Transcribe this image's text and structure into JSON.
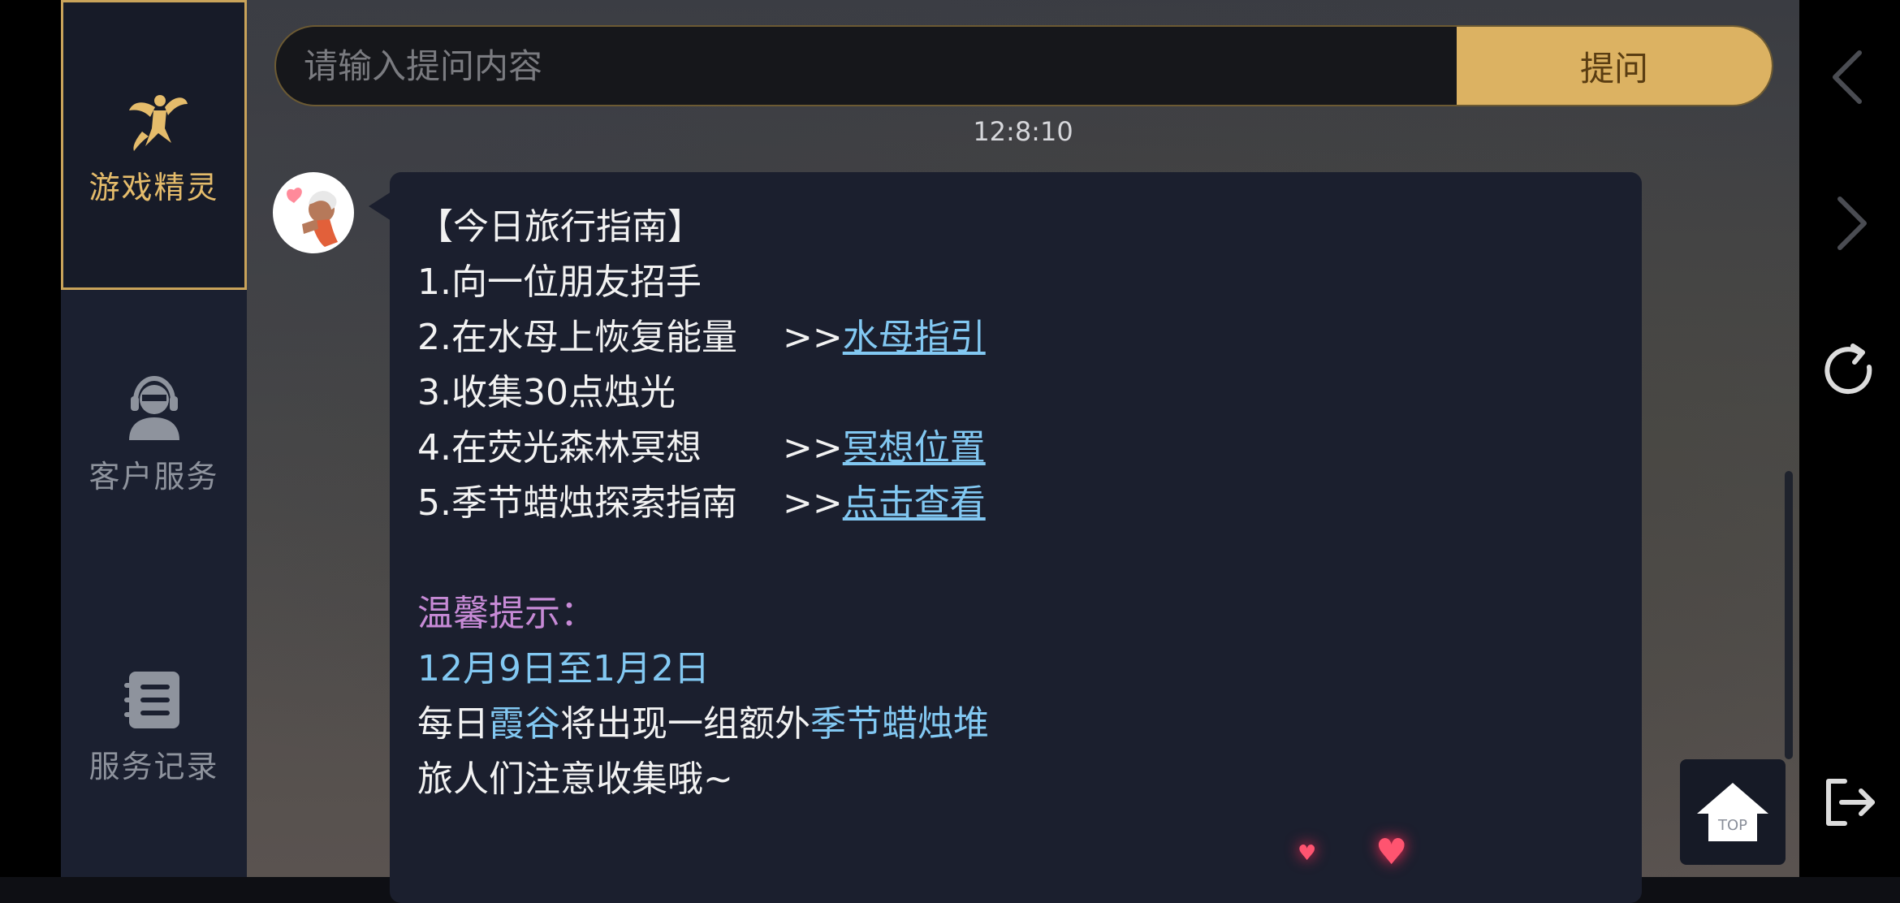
{
  "sidebar": {
    "items": [
      {
        "label": "游戏精灵",
        "icon": "fairy-icon",
        "active": true
      },
      {
        "label": "客户服务",
        "icon": "customer-service-icon",
        "active": false
      },
      {
        "label": "服务记录",
        "icon": "notebook-icon",
        "active": false
      }
    ]
  },
  "search": {
    "placeholder": "请输入提问内容",
    "button_label": "提问"
  },
  "timestamp": "12:8:10",
  "message": {
    "title": "【今日旅行指南】",
    "items": [
      {
        "text": "1.向一位朋友招手"
      },
      {
        "text": "2.在水母上恢复能量",
        "arrow": ">>",
        "link": "水母指引"
      },
      {
        "text": "3.收集30点烛光"
      },
      {
        "text": "4.在荧光森林冥想",
        "arrow": ">>",
        "link": "冥想位置"
      },
      {
        "text": "5.季节蜡烛探索指南",
        "arrow": ">>",
        "link": "点击查看"
      }
    ],
    "tip_title": "温馨提示：",
    "tip_date": "12月9日至1月2日",
    "tip_line1_a": "每日",
    "tip_line1_b": "霞谷",
    "tip_line1_c": "将出现一组额外",
    "tip_line1_d": "季节蜡烛堆",
    "tip_line2": "旅人们注意收集哦~"
  },
  "top_button": {
    "label": "TOP"
  },
  "colors": {
    "accent": "#dcb262",
    "link": "#82c8f2",
    "tip": "#c78ad6",
    "bubble": "#1b1f2e"
  },
  "right_nav": [
    "back-icon",
    "forward-icon",
    "refresh-icon",
    "exit-icon"
  ]
}
